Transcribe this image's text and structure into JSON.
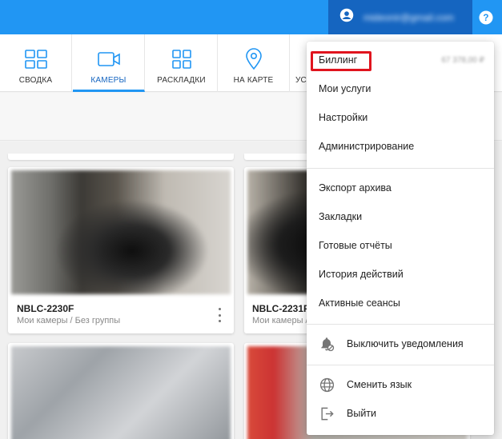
{
  "header": {
    "account_email": "mideonir@gmail.com",
    "help_label": "?"
  },
  "nav": {
    "tabs": [
      {
        "label": "СВОДКА",
        "icon": "grid-icon"
      },
      {
        "label": "КАМЕРЫ",
        "icon": "video-camera-icon"
      },
      {
        "label": "РАСКЛАДКИ",
        "icon": "layout-grid-icon"
      },
      {
        "label": "НА КАРТЕ",
        "icon": "map-pin-icon"
      },
      {
        "label": "УС"
      }
    ],
    "active_tab": "КАМЕРЫ"
  },
  "cameras": [
    {
      "name": "NBLC-2230F",
      "group": "Мои камеры / Без группы"
    },
    {
      "name": "NBLC-2231F",
      "group": "Мои камеры / Без группы"
    }
  ],
  "menu": {
    "billing": {
      "label": "Биллинг",
      "balance": "67 378,00 ₽"
    },
    "section1": [
      "Мои услуги",
      "Настройки",
      "Администрирование"
    ],
    "section2": [
      "Экспорт архива",
      "Закладки",
      "Готовые отчёты",
      "История действий",
      "Активные сеансы"
    ],
    "notifications_label": "Выключить уведомления",
    "language_label": "Сменить язык",
    "logout_label": "Выйти"
  },
  "colors": {
    "topbar": "#2196f3",
    "account_button": "#1565c0",
    "highlight": "#e0141e"
  }
}
